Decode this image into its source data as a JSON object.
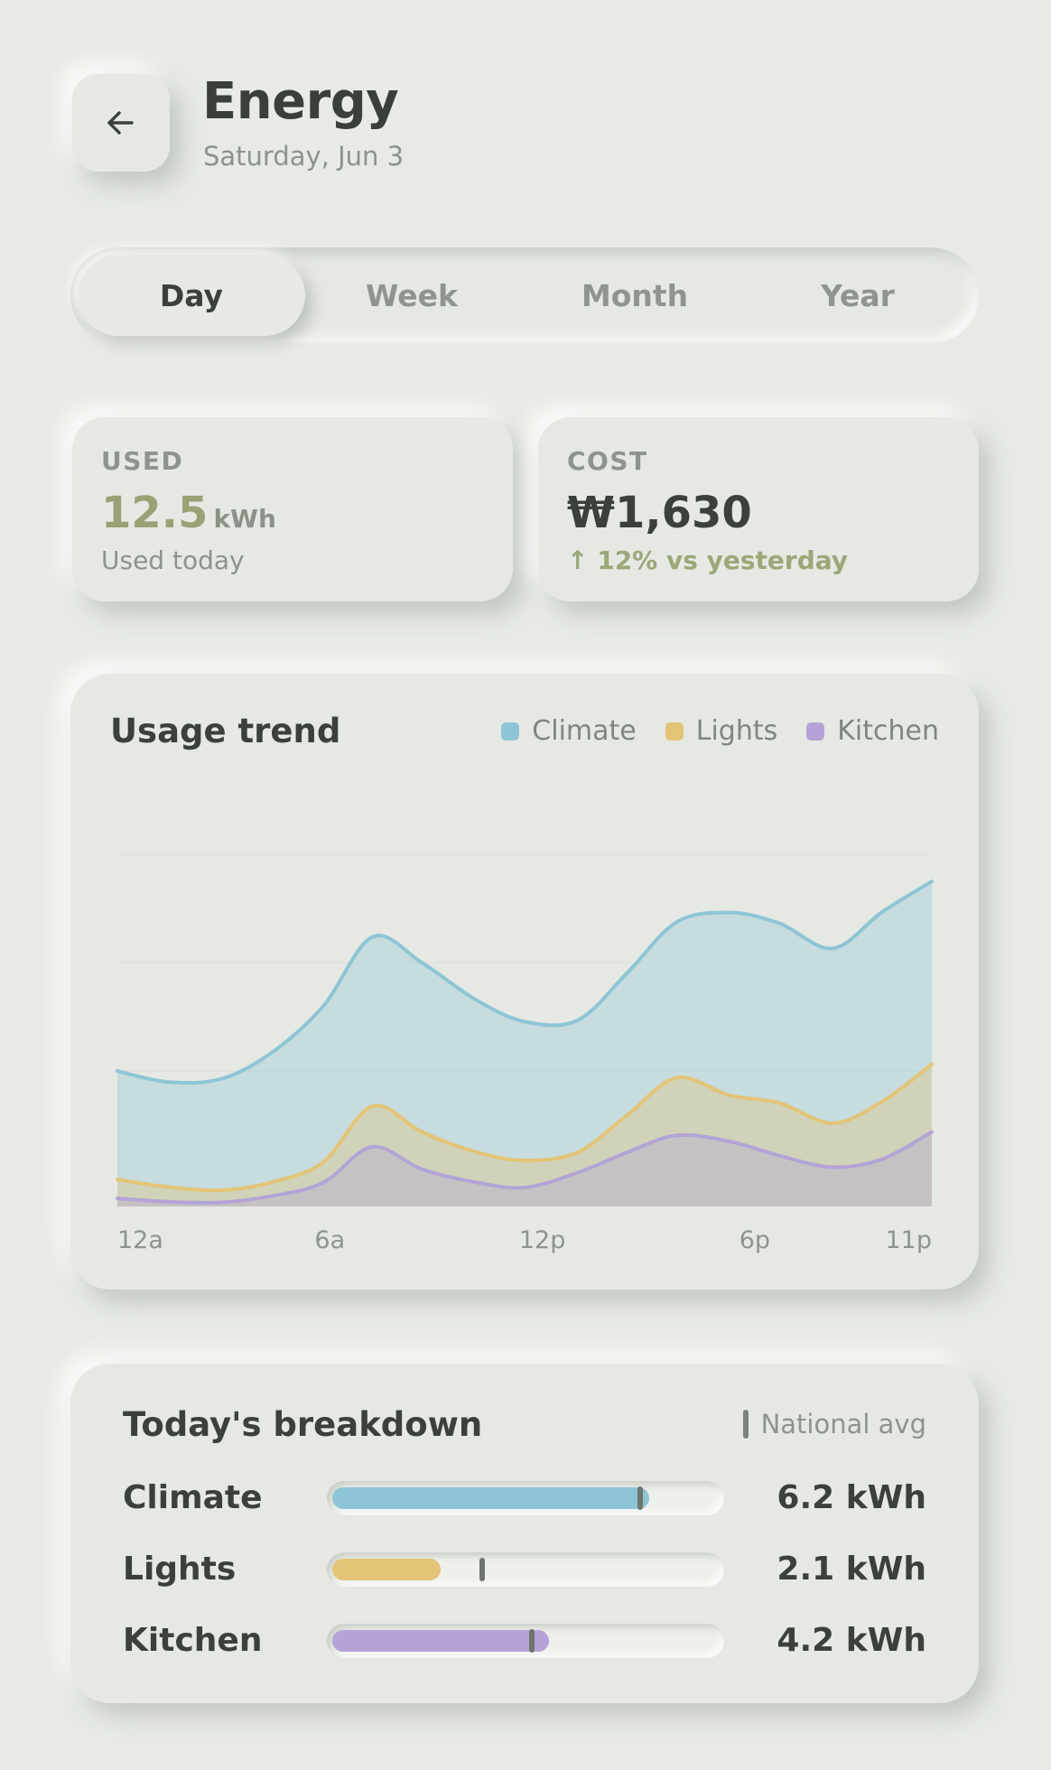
{
  "header": {
    "title": "Energy",
    "date": "Saturday, Jun 3",
    "back_icon": "arrow-left-icon"
  },
  "tabs": [
    {
      "label": "Day",
      "active": true
    },
    {
      "label": "Week",
      "active": false
    },
    {
      "label": "Month",
      "active": false
    },
    {
      "label": "Year",
      "active": false
    }
  ],
  "used": {
    "label": "USED",
    "value": "12.5",
    "unit": "kWh",
    "sub": "Used today",
    "accent": "#98a276"
  },
  "cost": {
    "label": "COST",
    "value": "₩1,630",
    "change": "↑ 12% vs yesterday",
    "change_color": "#9ba778"
  },
  "colors": {
    "climate": "#8ec5d6",
    "lights": "#e4c477",
    "kitchen": "#b4a3d6"
  },
  "chart_data": {
    "type": "area",
    "title": "Usage trend",
    "stacked": true,
    "x": [
      0,
      1.4,
      2.9,
      4.3,
      5.8,
      7.2,
      8.6,
      10.1,
      11.5,
      13.0,
      14.4,
      15.8,
      17.3,
      18.7,
      20.2,
      21.6,
      23
    ],
    "x_tick_labels": [
      "12a",
      "6a",
      "12p",
      "6p",
      "11p"
    ],
    "x_tick_positions": [
      0,
      6,
      12,
      18,
      23
    ],
    "series": [
      {
        "name": "Kitchen",
        "color": "#b4a3d6",
        "values": [
          0.12,
          0.07,
          0.06,
          0.15,
          0.35,
          0.88,
          0.55,
          0.36,
          0.28,
          0.5,
          0.8,
          1.05,
          0.96,
          0.75,
          0.58,
          0.7,
          1.1
        ]
      },
      {
        "name": "Lights",
        "color": "#e4c477",
        "values": [
          0.28,
          0.22,
          0.18,
          0.2,
          0.3,
          0.6,
          0.55,
          0.45,
          0.4,
          0.3,
          0.55,
          0.85,
          0.68,
          0.78,
          0.65,
          0.85,
          1.0
        ]
      },
      {
        "name": "Climate",
        "color": "#8ec5d6",
        "values": [
          1.6,
          1.55,
          1.64,
          1.9,
          2.3,
          2.5,
          2.5,
          2.25,
          2.05,
          1.95,
          2.1,
          2.3,
          2.7,
          2.65,
          2.58,
          2.8,
          2.7
        ]
      }
    ],
    "ylim": [
      0,
      6.4
    ],
    "grid": true,
    "legend_position": "top-right"
  },
  "breakdown": {
    "title": "Today's breakdown",
    "avg_label": "National avg",
    "rows": [
      {
        "name": "Climate",
        "value": "6.2 kWh",
        "fill": 0.82,
        "avg": 0.79,
        "color": "#8ec5d6"
      },
      {
        "name": "Lights",
        "value": "2.1 kWh",
        "fill": 0.28,
        "avg": 0.38,
        "color": "#e4c477"
      },
      {
        "name": "Kitchen",
        "value": "4.2 kWh",
        "fill": 0.56,
        "avg": 0.51,
        "color": "#b4a3d6"
      }
    ]
  }
}
